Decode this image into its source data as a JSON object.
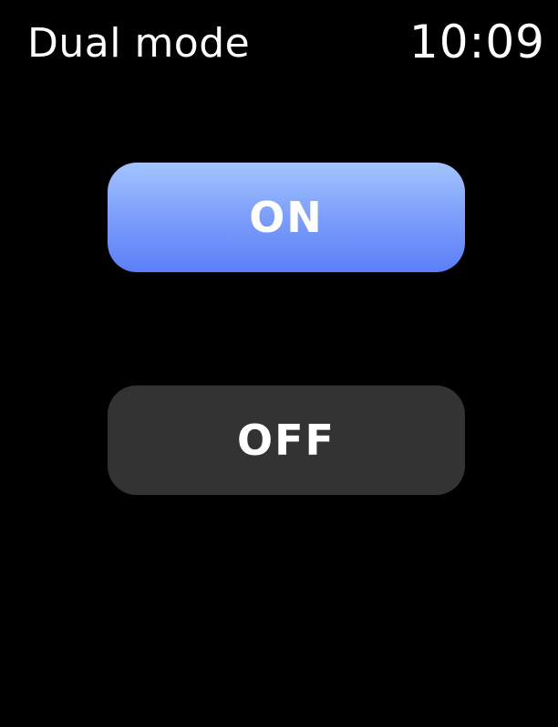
{
  "header": {
    "title": "Dual mode",
    "time": "10:09"
  },
  "options": {
    "on_label": "ON",
    "off_label": "OFF",
    "selected": "ON"
  },
  "colors": {
    "background": "#000000",
    "on_gradient_top": "#a3c4fd",
    "on_gradient_bottom": "#5b7ff8",
    "off_background": "#333333",
    "text": "#ffffff"
  }
}
